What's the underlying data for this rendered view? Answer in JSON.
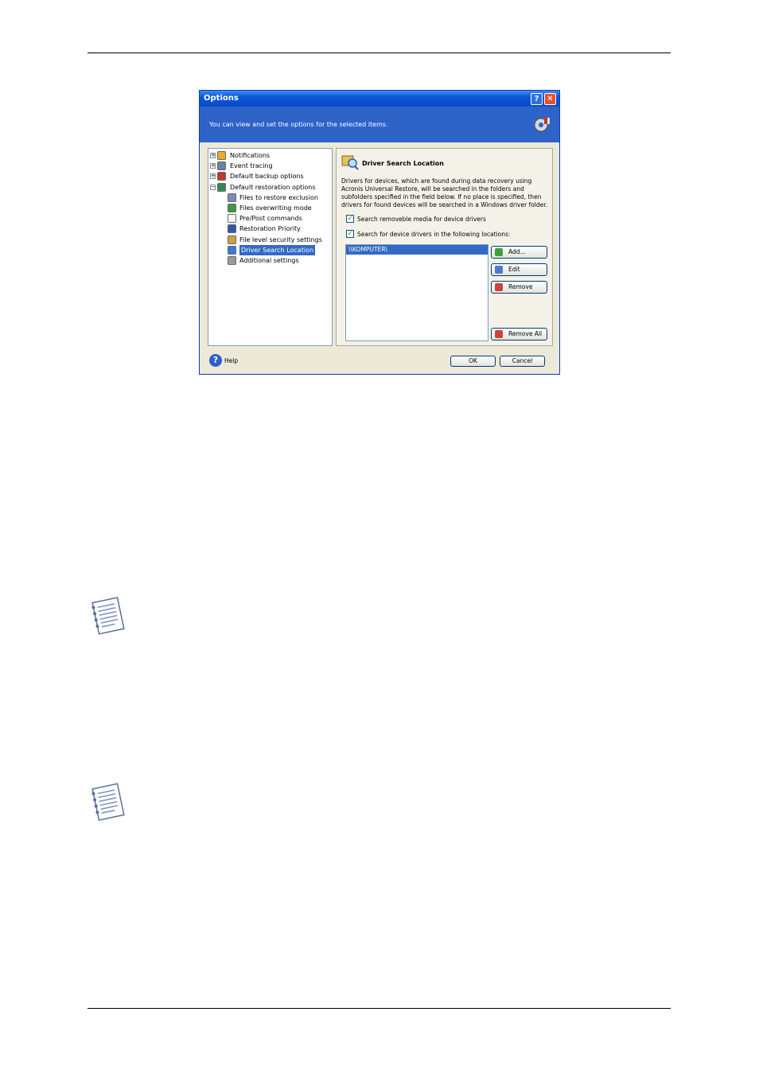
{
  "dialog": {
    "title": "Options",
    "banner_text": "You can view and set the options for the selected items.",
    "tree": [
      {
        "label": "Notifications",
        "expander": "+",
        "icon_color": "#e8b020",
        "icon": "notifications-icon"
      },
      {
        "label": "Event tracing",
        "expander": "+",
        "icon_color": "#6a7fae",
        "icon": "event-tracing-icon"
      },
      {
        "label": "Default backup options",
        "expander": "+",
        "icon_color": "#c0392b",
        "icon": "backup-options-icon"
      },
      {
        "label": "Default restoration options",
        "expander": "−",
        "icon_color": "#2e8b57",
        "icon": "restoration-options-icon"
      },
      {
        "label": "Files to restore exclusion",
        "icon_color": "#7a8fb5",
        "icon": "exclusion-icon"
      },
      {
        "label": "Files overwriting mode",
        "icon_color": "#3c9b3c",
        "icon": "overwrite-icon"
      },
      {
        "label": "Pre/Post commands",
        "icon_color": "#ffffff",
        "icon": "commands-icon"
      },
      {
        "label": "Restoration Priority",
        "icon_color": "#3457a8",
        "icon": "priority-icon"
      },
      {
        "label": "File level security settings",
        "icon_color": "#c9a24a",
        "icon": "security-icon"
      },
      {
        "label": "Driver Search Location",
        "icon_color": "#3a7bd5",
        "icon": "driver-search-icon",
        "selected": true
      },
      {
        "label": "Additional settings",
        "icon_color": "#9a9a9a",
        "icon": "additional-settings-icon"
      }
    ],
    "panel": {
      "title": "Driver Search Location",
      "description": "Drivers for devices, which are found during data recovery using Acronis Universal Restore, will be searched in the folders and subfolders specified in the field below. If no place is specified, then drivers for found devices will be searched in a Windows driver folder.",
      "check1": "Search removeble media for device drivers",
      "check2": "Search for device drivers in the following locations:",
      "list_item": "\\\\KOMPUTER\\",
      "add": "Add...",
      "edit": "Edit",
      "remove": "Remove",
      "remove_all": "Remove All"
    },
    "help": "Help",
    "ok": "OK",
    "cancel": "Cancel"
  }
}
